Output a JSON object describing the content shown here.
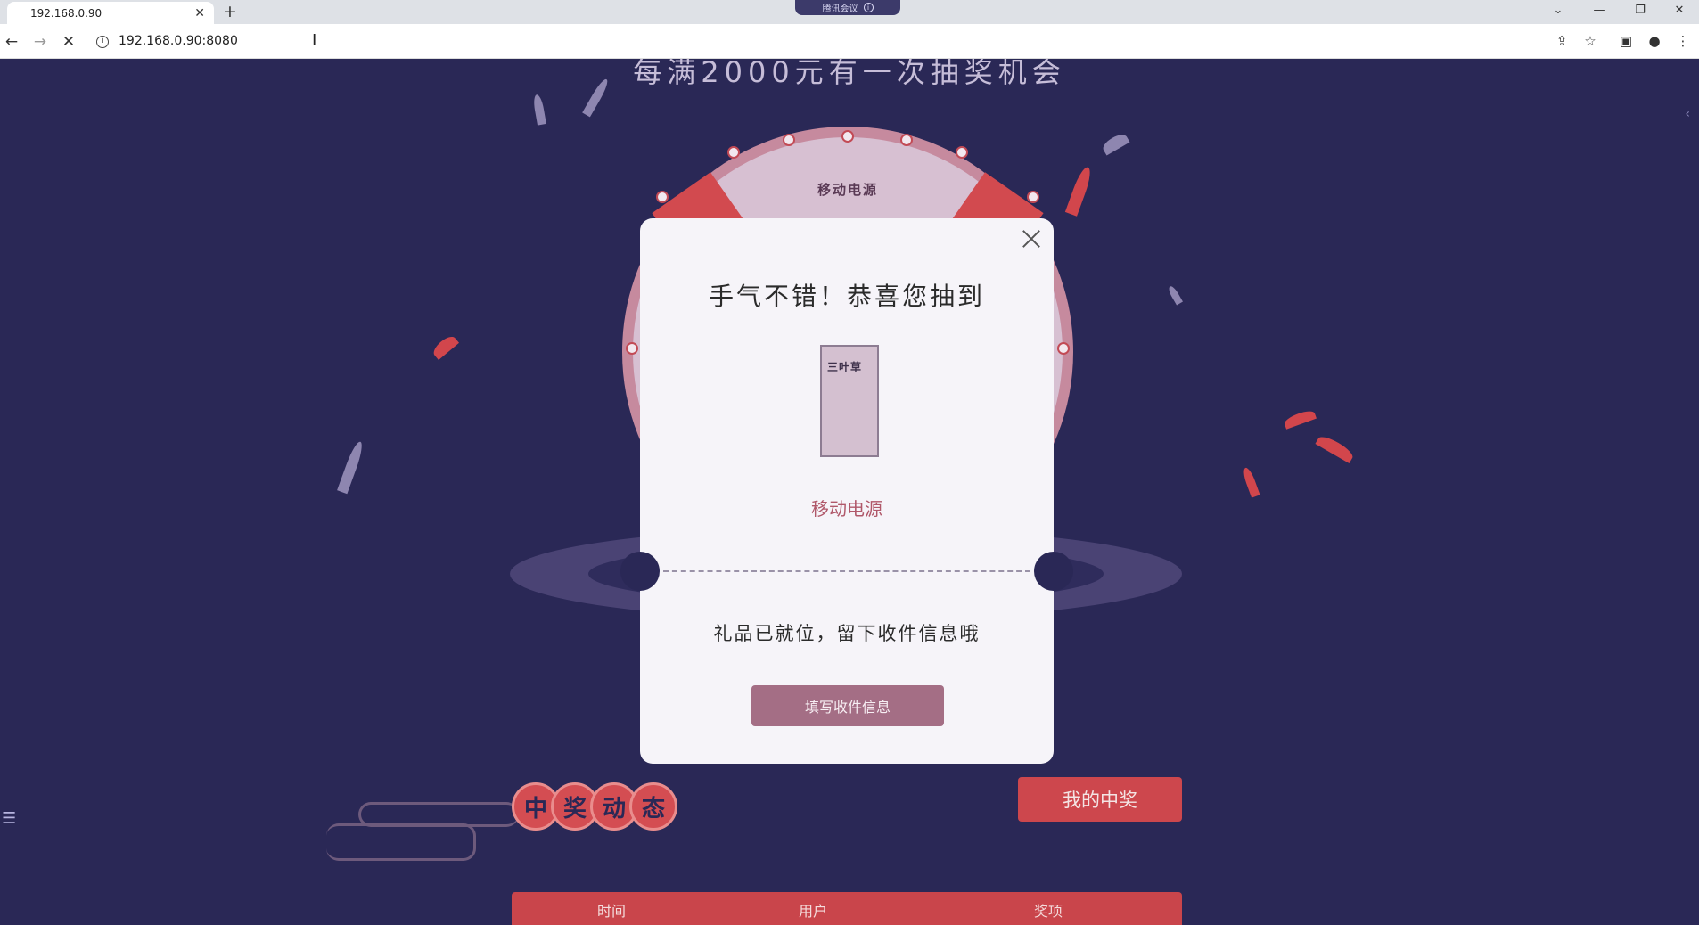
{
  "browser": {
    "tab_title": "192.168.0.90",
    "tab_close": "✕",
    "new_tab": "+",
    "meeting_badge": "腾讯会议",
    "meeting_info": "i",
    "url": "192.168.0.90:8080",
    "win_min": "—",
    "win_restore": "❐",
    "win_close": "✕",
    "win_dropdown": "⌄"
  },
  "page": {
    "headline": "每满2000元有一次抽奖机会",
    "wheel_label": "移动电源",
    "winners_badge": [
      "中",
      "奖",
      "动",
      "态"
    ],
    "my_prize_button": "我的中奖",
    "table_headers": [
      "时间",
      "用户",
      "奖项"
    ]
  },
  "modal": {
    "title": "手气不错！恭喜您抽到",
    "prize_brand": "三叶草",
    "prize_name": "移动电源",
    "subtitle": "礼品已就位，留下收件信息哦",
    "fill_button": "填写收件信息"
  },
  "colors": {
    "background": "#2a2856",
    "accent_red": "#cd474d",
    "modal_button": "#a46e85",
    "prize_text": "#b0586a"
  }
}
